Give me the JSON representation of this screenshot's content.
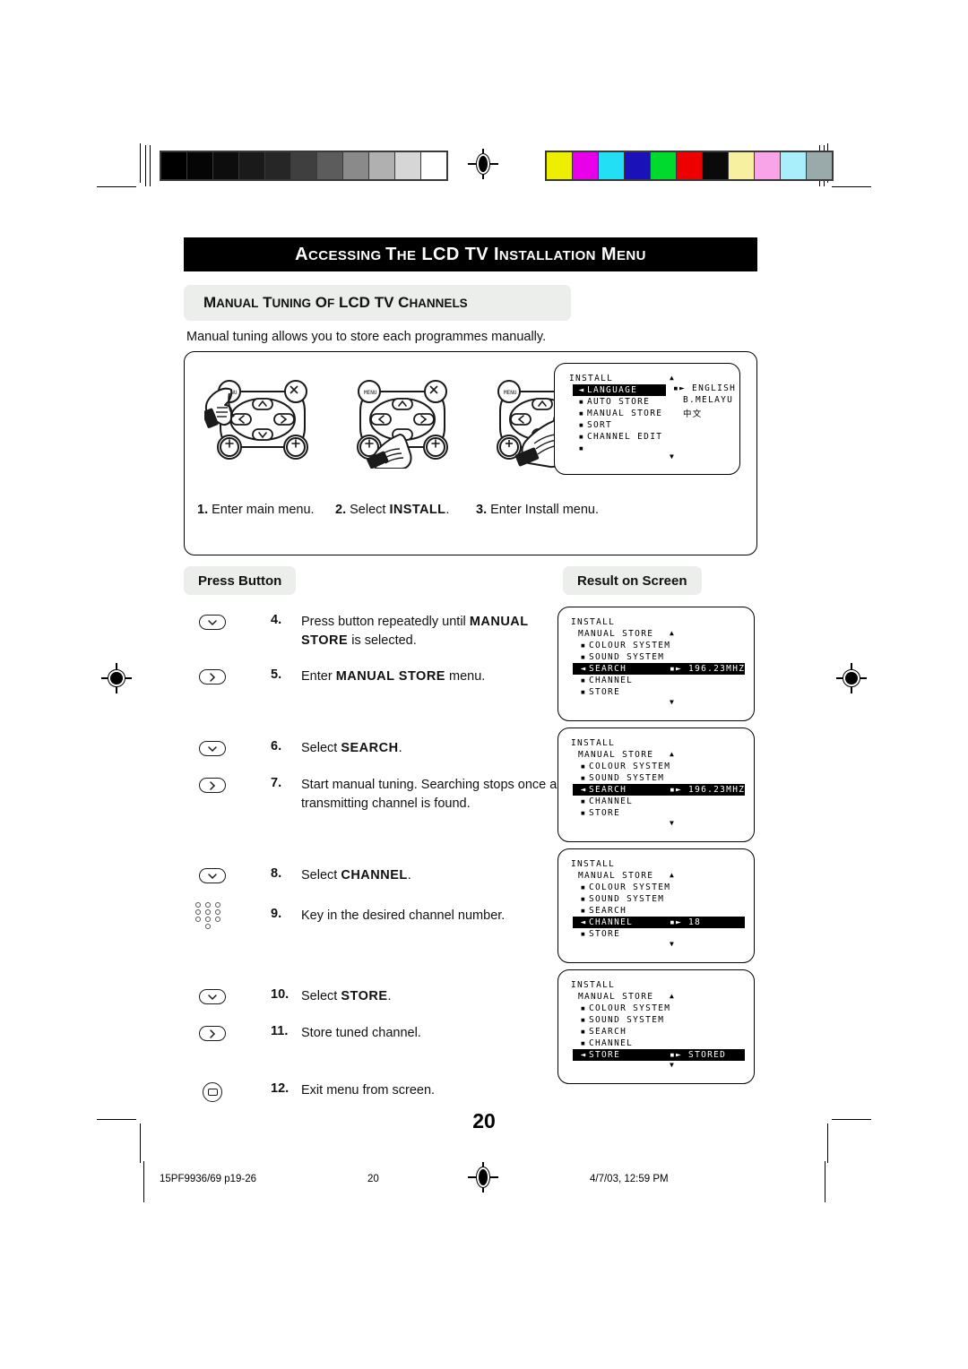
{
  "document": {
    "title": "Accessing the LCD TV Installation Menu",
    "title_parts": [
      {
        "text": "A",
        "size": "large"
      },
      {
        "text": "CCESSING",
        "size": "small"
      },
      {
        "text": " ",
        "size": "small"
      },
      {
        "text": "T",
        "size": "large"
      },
      {
        "text": "HE",
        "size": "small"
      },
      {
        "text": " LCD TV ",
        "size": "large"
      },
      {
        "text": "I",
        "size": "large"
      },
      {
        "text": "NSTALLATION",
        "size": "small"
      },
      {
        "text": " M",
        "size": "large"
      },
      {
        "text": "ENU",
        "size": "small"
      }
    ],
    "subtitle": "Manual Tuning of LCD TV Channels",
    "intro": "Manual tuning allows you to store each programmes manually.",
    "page_number": "20"
  },
  "top_illustration": {
    "captions": [
      {
        "number": "1.",
        "text": "Enter main menu.",
        "bold": ""
      },
      {
        "number": "2.",
        "text": "Select ",
        "bold": "INSTALL",
        "suffix": "."
      },
      {
        "number": "3.",
        "text": "Enter Install menu.",
        "bold": ""
      }
    ],
    "remotes": [
      {
        "name": "remote-press-menu",
        "pressed": "menu"
      },
      {
        "name": "remote-press-down",
        "pressed": "down"
      },
      {
        "name": "remote-press-right",
        "pressed": "right"
      }
    ],
    "osd": {
      "header": "INSTALL",
      "up_arrow": "▲",
      "down_arrow": "▼",
      "left_arrow": "◄",
      "right_arrow": "►",
      "bullet": "▪",
      "items": [
        {
          "label": "LANGUAGE",
          "highlight": true,
          "value": "ENGLISH",
          "has_arrows": true
        },
        {
          "label": "AUTO STORE",
          "highlight": false,
          "value": "B.MELAYU",
          "has_arrows": false
        },
        {
          "label": "MANUAL STORE",
          "highlight": false,
          "value": "中文",
          "has_arrows": false
        },
        {
          "label": "SORT",
          "highlight": false,
          "value": "",
          "has_arrows": false
        },
        {
          "label": "CHANNEL EDIT",
          "highlight": false,
          "value": "",
          "has_arrows": false
        },
        {
          "label": "",
          "highlight": false,
          "value": "",
          "has_arrows": false
        }
      ]
    }
  },
  "columns": {
    "press_button": "Press Button",
    "result_on_screen": "Result on Screen"
  },
  "steps": [
    {
      "number": "4.",
      "icon": "down-chevron-button",
      "text_before": "Press button repeatedly until ",
      "bold": "MANUAL STORE",
      "text_after": " is selected."
    },
    {
      "number": "5.",
      "icon": "right-chevron-button",
      "text_before": "Enter ",
      "bold": "MANUAL STORE",
      "text_after": " menu."
    },
    {
      "number": "6.",
      "icon": "down-chevron-button",
      "text_before": "Select ",
      "bold": "SEARCH",
      "text_after": "."
    },
    {
      "number": "7.",
      "icon": "right-chevron-button",
      "text_before": "Start manual tuning. Searching stops once a transmitting channel is found.",
      "bold": "",
      "text_after": ""
    },
    {
      "number": "8.",
      "icon": "down-chevron-button",
      "text_before": "Select ",
      "bold": "CHANNEL",
      "text_after": "."
    },
    {
      "number": "9.",
      "icon": "numeric-keypad",
      "text_before": "Key in the desired channel number.",
      "bold": "",
      "text_after": ""
    },
    {
      "number": "10.",
      "icon": "down-chevron-button",
      "text_before": "Select ",
      "bold": "STORE",
      "text_after": "."
    },
    {
      "number": "11.",
      "icon": "right-chevron-button",
      "text_before": "Store tuned channel.",
      "bold": "",
      "text_after": ""
    },
    {
      "number": "12.",
      "icon": "exit-button",
      "text_before": "Exit menu from screen.",
      "bold": "",
      "text_after": ""
    }
  ],
  "result_screens": [
    {
      "name": "osd-search-1",
      "header": "INSTALL",
      "submenu": "MANUAL STORE",
      "items": [
        {
          "label": "COLOUR SYSTEM",
          "highlight": false,
          "value": ""
        },
        {
          "label": "SOUND SYSTEM",
          "highlight": false,
          "value": ""
        },
        {
          "label": "SEARCH",
          "highlight": true,
          "value": "196.23MHZ"
        },
        {
          "label": "CHANNEL",
          "highlight": false,
          "value": ""
        },
        {
          "label": "STORE",
          "highlight": false,
          "value": ""
        }
      ]
    },
    {
      "name": "osd-search-2",
      "header": "INSTALL",
      "submenu": "MANUAL STORE",
      "items": [
        {
          "label": "COLOUR SYSTEM",
          "highlight": false,
          "value": ""
        },
        {
          "label": "SOUND SYSTEM",
          "highlight": false,
          "value": ""
        },
        {
          "label": "SEARCH",
          "highlight": true,
          "value": "196.23MHZ"
        },
        {
          "label": "CHANNEL",
          "highlight": false,
          "value": ""
        },
        {
          "label": "STORE",
          "highlight": false,
          "value": ""
        }
      ]
    },
    {
      "name": "osd-channel",
      "header": "INSTALL",
      "submenu": "MANUAL STORE",
      "items": [
        {
          "label": "COLOUR SYSTEM",
          "highlight": false,
          "value": ""
        },
        {
          "label": "SOUND SYSTEM",
          "highlight": false,
          "value": ""
        },
        {
          "label": "SEARCH",
          "highlight": false,
          "value": ""
        },
        {
          "label": "CHANNEL",
          "highlight": true,
          "value": "18"
        },
        {
          "label": "STORE",
          "highlight": false,
          "value": ""
        }
      ]
    },
    {
      "name": "osd-store",
      "header": "INSTALL",
      "submenu": "MANUAL STORE",
      "items": [
        {
          "label": "COLOUR SYSTEM",
          "highlight": false,
          "value": ""
        },
        {
          "label": "SOUND SYSTEM",
          "highlight": false,
          "value": ""
        },
        {
          "label": "SEARCH",
          "highlight": false,
          "value": ""
        },
        {
          "label": "CHANNEL",
          "highlight": false,
          "value": ""
        },
        {
          "label": "STORE",
          "highlight": true,
          "value": "STORED"
        }
      ]
    }
  ],
  "footer": {
    "left": "15PF9936/69 p19-26",
    "center": "20",
    "right": "4/7/03, 12:59 PM"
  },
  "calibration": {
    "grayscale": [
      "#000000",
      "#050505",
      "#0d0d0d",
      "#1a1a1a",
      "#262626",
      "#3f3f3f",
      "#5c5c5c",
      "#8a8a8a",
      "#b0b0b0",
      "#d6d6d6",
      "#ffffff"
    ],
    "colors": [
      "#eeee00",
      "#e800e8",
      "#22dff5",
      "#1a11b8",
      "#00d92e",
      "#ee0000",
      "#0a0a0a",
      "#f7f0a0",
      "#f9a3e8",
      "#a8eefb",
      "#9aa9a9"
    ]
  }
}
